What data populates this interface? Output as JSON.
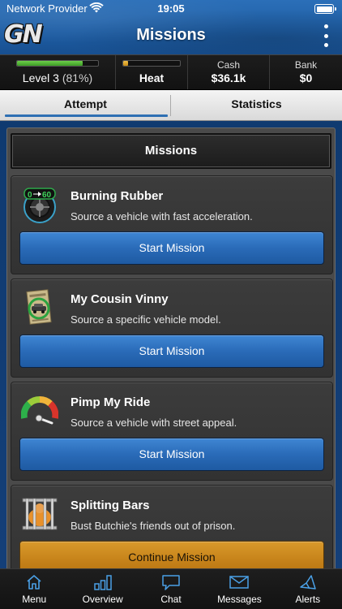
{
  "status_bar": {
    "carrier": "Network Provider",
    "time": "19:05"
  },
  "header": {
    "logo": "GN",
    "title": "Missions"
  },
  "stats": {
    "level": {
      "label": "Level 3",
      "percent_text": "(81%)",
      "progress": 0.81
    },
    "heat": {
      "label": "Heat",
      "progress": 0.08
    },
    "cash": {
      "label": "Cash",
      "value": "$36.1k"
    },
    "bank": {
      "label": "Bank",
      "value": "$0"
    }
  },
  "tabs": [
    {
      "label": "Attempt",
      "active": true
    },
    {
      "label": "Statistics",
      "active": false
    }
  ],
  "panel": {
    "title": "Missions"
  },
  "missions": [
    {
      "title": "Burning Rubber",
      "description": "Source a vehicle with fast acceleration.",
      "button": "Start Mission",
      "button_style": "blue",
      "icon": "speedometer-tire-icon"
    },
    {
      "title": "My Cousin Vinny",
      "description": "Source a specific vehicle model.",
      "button": "Start Mission",
      "button_style": "blue",
      "icon": "car-document-icon"
    },
    {
      "title": "Pimp My Ride",
      "description": "Source a vehicle with street appeal.",
      "button": "Start Mission",
      "button_style": "blue",
      "icon": "gauge-icon"
    },
    {
      "title": "Splitting Bars",
      "description": "Bust Butchie's friends out of prison.",
      "button": "Continue Mission",
      "button_style": "orange",
      "icon": "prison-bars-icon"
    }
  ],
  "nav": [
    {
      "label": "Menu",
      "icon": "home-icon"
    },
    {
      "label": "Overview",
      "icon": "bar-chart-icon"
    },
    {
      "label": "Chat",
      "icon": "chat-bubble-icon"
    },
    {
      "label": "Messages",
      "icon": "envelope-icon"
    },
    {
      "label": "Alerts",
      "icon": "megaphone-icon"
    }
  ],
  "colors": {
    "header_blue": "#1f5fa6",
    "button_blue": "#2a6bb8",
    "button_orange": "#c9861c",
    "level_green": "#3c9c25",
    "heat_yellow": "#c98c16"
  }
}
